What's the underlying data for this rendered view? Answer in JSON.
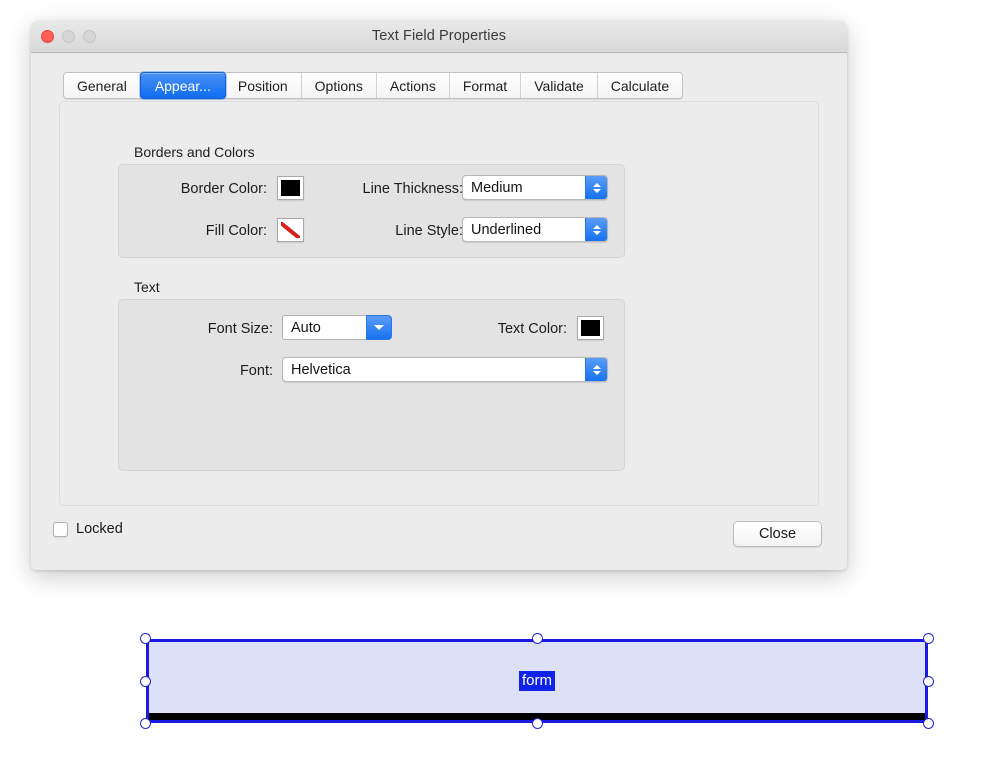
{
  "window": {
    "title": "Text Field Properties",
    "traffic_lights": [
      {
        "name": "close-window-button",
        "color": "#ff5f57"
      },
      {
        "name": "minimize-window-button",
        "color": "#d6d6d6"
      },
      {
        "name": "maximize-window-button",
        "color": "#d6d6d6"
      }
    ]
  },
  "tabs": [
    {
      "label": "General",
      "active": false
    },
    {
      "label": "Appear...",
      "active": true
    },
    {
      "label": "Position",
      "active": false
    },
    {
      "label": "Options",
      "active": false
    },
    {
      "label": "Actions",
      "active": false
    },
    {
      "label": "Format",
      "active": false
    },
    {
      "label": "Validate",
      "active": false
    },
    {
      "label": "Calculate",
      "active": false
    }
  ],
  "borders_and_colors": {
    "group_label": "Borders and Colors",
    "border_color_label": "Border Color:",
    "border_color_value": "#000000",
    "fill_color_label": "Fill Color:",
    "fill_color_value": "none",
    "line_thickness_label": "Line Thickness:",
    "line_thickness_value": "Medium",
    "line_style_label": "Line Style:",
    "line_style_value": "Underlined"
  },
  "text_section": {
    "group_label": "Text",
    "font_size_label": "Font Size:",
    "font_size_value": "Auto",
    "text_color_label": "Text Color:",
    "text_color_value": "#000000",
    "font_label": "Font:",
    "font_value": "Helvetica"
  },
  "footer": {
    "locked_label": "Locked",
    "locked_checked": false,
    "close_label": "Close"
  },
  "form_field": {
    "text": "form",
    "fill": "#dde1f7",
    "selection_border": "#1a1ae0",
    "underline": "#000000",
    "text_highlight": "#0f23e8"
  }
}
